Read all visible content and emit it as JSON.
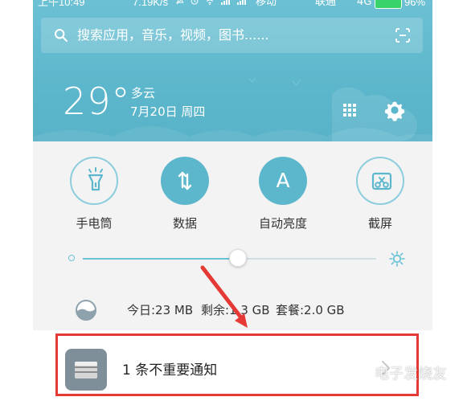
{
  "status_bar": {
    "time": "上午10:49",
    "speed": "7.19K/s",
    "icons": [
      "bell-mute-icon",
      "alarm-icon",
      "wifi-icon",
      "signal-icon",
      "signal-icon"
    ],
    "carrier1": "移动",
    "carrier2": "联通",
    "network": "4G",
    "battery": "96%",
    "battery_color": "#38d46b"
  },
  "search": {
    "placeholder": "搜索应用，音乐，视频，图书......",
    "icon": "search-icon",
    "scan_icon": "scan-icon"
  },
  "weather": {
    "temperature": "29°",
    "condition": "多云",
    "date": "7月20日 周四",
    "grid_icon": "grid-icon",
    "settings_icon": "gear-icon"
  },
  "toggles": [
    {
      "label": "手电筒",
      "icon": "flashlight-icon",
      "style": "outline"
    },
    {
      "label": "数据",
      "icon": "data-transfer-icon",
      "style": "filled"
    },
    {
      "label": "自动亮度",
      "icon": "auto-brightness-icon",
      "style": "filled",
      "icon_text": "A"
    },
    {
      "label": "截屏",
      "icon": "screenshot-icon",
      "style": "outline"
    }
  ],
  "brightness": {
    "level": 0.53,
    "accent": "#69c2d6",
    "min_icon": "brightness-low-icon",
    "max_icon": "brightness-high-icon"
  },
  "data_usage": {
    "icon": "data-usage-icon",
    "today": "今日:23 MB",
    "remaining": "剩余:1.3 GB",
    "plan": "套餐:2.0 GB"
  },
  "notification": {
    "icon": "notification-app-icon",
    "text": "1 条不重要通知",
    "chevron_icon": "chevron-right-icon"
  },
  "annotations": {
    "highlight_color": "#e53935",
    "arrow_color": "#e53935"
  },
  "watermark": {
    "text": "电子发烧友",
    "logo_icon": "electronics-logo-icon"
  }
}
